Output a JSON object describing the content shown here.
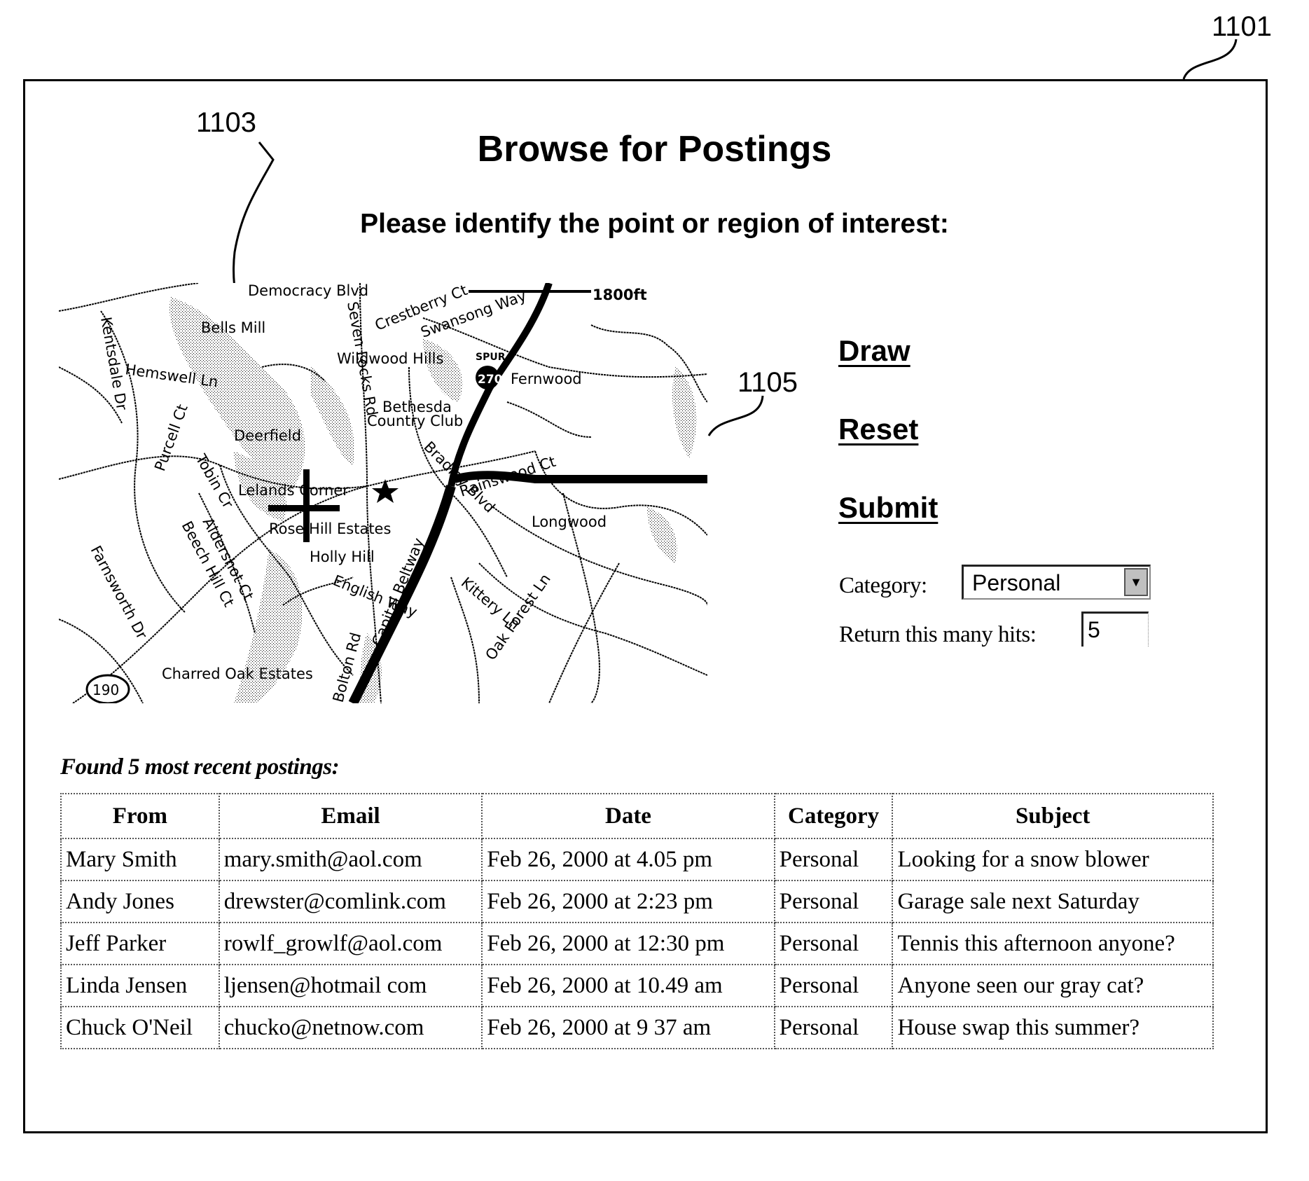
{
  "figure_refs": {
    "window": "1101",
    "map_marker": "1103",
    "map_boundary": "1105"
  },
  "header": {
    "title": "Browse for Postings",
    "subtitle": "Please identify the point or region of interest:"
  },
  "map": {
    "scale_label": "1800ft",
    "highway_shield": "270",
    "spur_label": "SPUR",
    "route_shield": "190",
    "labels": {
      "democracy": "Democracy Blvd",
      "crestberry": "Crestberry Ct",
      "swansong": "Swansong Way",
      "bells_mill": "Bells Mill",
      "seven_locks": "Seven Locks Rd",
      "wildwood": "Wildwood Hills",
      "fernwood": "Fernwood",
      "kentsdale": "Kentsdale Dr",
      "hemswell": "Hemswell Ln",
      "bethesda": "Bethesda",
      "country_club": "Country Club",
      "deerfield": "Deerfield",
      "purcell": "Purcell Ct",
      "tobin": "Tobin Cr",
      "lelands": "Lelands Corner",
      "bradley": "Bradley Blvd",
      "rainswood": "Rainswood Ct",
      "rose_hill": "Rose Hill Estates",
      "longwood": "Longwood",
      "aldershot": "Aldershot Ct",
      "beech_hill": "Beech Hill Ct",
      "holly_hill": "Holly Hill",
      "farnsworth": "Farnsworth Dr",
      "english_way": "English Way",
      "capital_beltway": "Capital Beltway",
      "kittery": "Kittery Ln",
      "oak_forest": "Oak Forest Ln",
      "charred_oak": "Charred Oak Estates",
      "bolton": "Bolton Rd"
    }
  },
  "actions": {
    "draw": "Draw",
    "reset": "Reset",
    "submit": "Submit"
  },
  "form": {
    "category_label": "Category:",
    "category_value": "Personal",
    "hits_label": "Return this many hits:",
    "hits_value": "5"
  },
  "results": {
    "label": "Found 5 most recent postings:",
    "columns": [
      "From",
      "Email",
      "Date",
      "Category",
      "Subject"
    ],
    "rows": [
      [
        "Mary Smith",
        "mary.smith@aol.com",
        "Feb 26, 2000 at 4.05 pm",
        "Personal",
        "Looking for a snow blower"
      ],
      [
        "Andy Jones",
        "drewster@comlink.com",
        "Feb 26, 2000 at 2:23 pm",
        "Personal",
        "Garage sale next Saturday"
      ],
      [
        "Jeff Parker",
        "rowlf_growlf@aol.com",
        "Feb 26, 2000 at 12:30 pm",
        "Personal",
        "Tennis this afternoon anyone?"
      ],
      [
        "Linda Jensen",
        "ljensen@hotmail com",
        "Feb 26, 2000 at 10.49 am",
        "Personal",
        "Anyone seen our gray cat?"
      ],
      [
        "Chuck O'Neil",
        "chucko@netnow.com",
        "Feb 26, 2000 at 9 37 am",
        "Personal",
        "House swap this summer?"
      ]
    ]
  }
}
